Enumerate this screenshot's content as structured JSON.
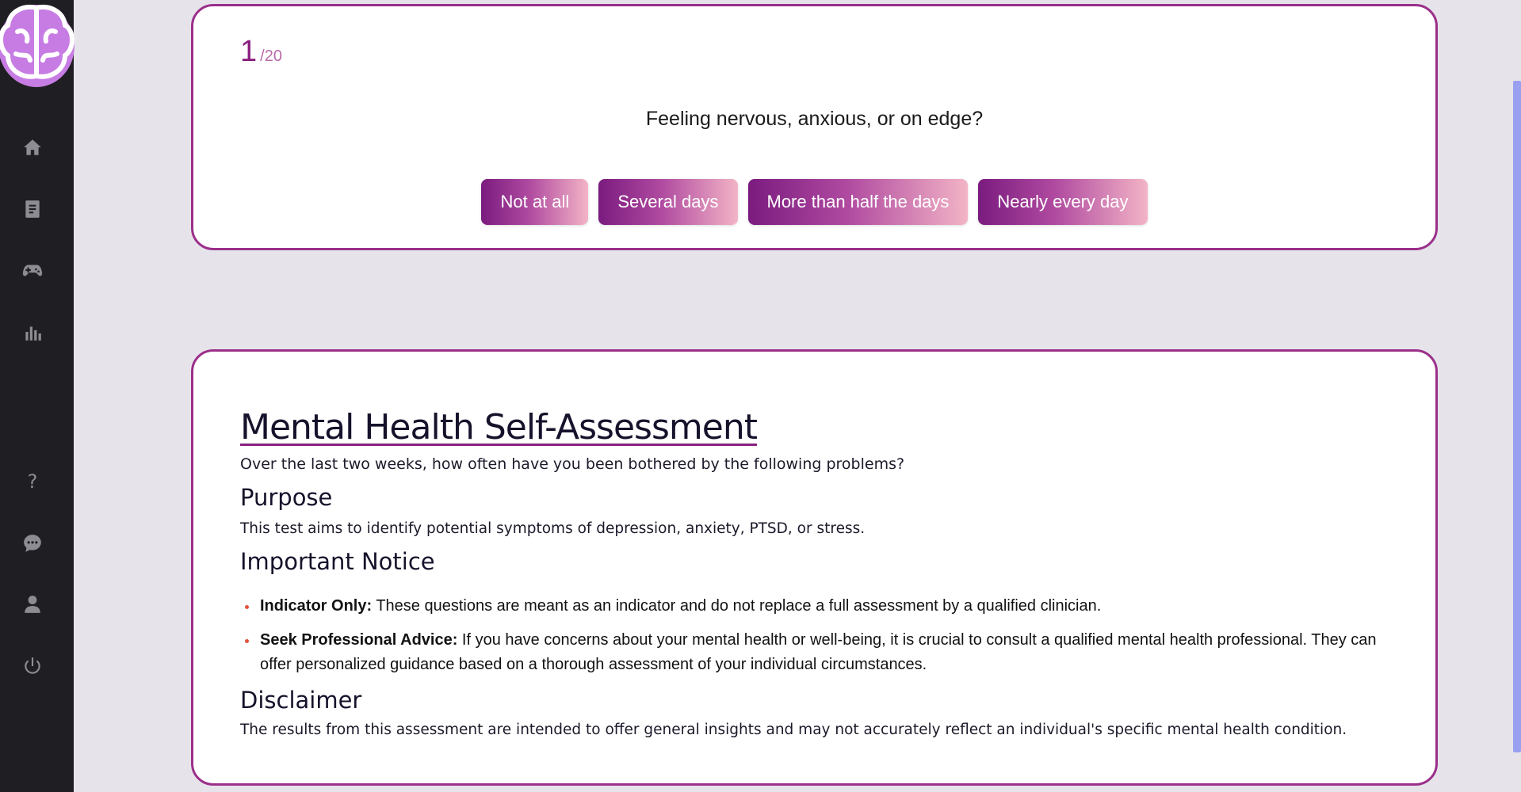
{
  "sidebar": {
    "items": [
      {
        "icon": "home-icon"
      },
      {
        "icon": "document-icon"
      },
      {
        "icon": "gamepad-icon"
      },
      {
        "icon": "bar-chart-icon"
      },
      {
        "icon": "help-icon",
        "glyph": "?"
      },
      {
        "icon": "chat-icon"
      },
      {
        "icon": "user-icon"
      },
      {
        "icon": "power-icon"
      }
    ]
  },
  "question": {
    "current": "1",
    "total": "/20",
    "text": "Feeling nervous, anxious, or on edge?",
    "options": [
      "Not at all",
      "Several days",
      "More than half the days",
      "Nearly every day"
    ]
  },
  "info": {
    "title": "Mental Health Self-Assessment",
    "subtitle": "Over the last two weeks, how often have you been bothered by the following problems?",
    "purpose_heading": "Purpose",
    "purpose_text": "This test aims to identify potential symptoms of depression, anxiety, PTSD, or stress.",
    "notice_heading": "Important Notice",
    "notices": [
      {
        "label": "Indicator Only:",
        "text": " These questions are meant as an indicator and do not replace a full assessment by a qualified clinician."
      },
      {
        "label": "Seek Professional Advice:",
        "text": " If you have concerns about your mental health or well-being, it is crucial to consult a qualified mental health professional. They can offer personalized guidance based on a thorough assessment of your individual circumstances."
      }
    ],
    "disclaimer_heading": "Disclaimer",
    "disclaimer_text": "The results from this assessment are intended to offer general insights and may not accurately reflect an individual's specific mental health condition."
  },
  "colors": {
    "accent": "#8a1e7f",
    "card_border": "#9b2f8a",
    "sidebar_bg": "#1f1e22",
    "page_bg": "#e6e4ea",
    "button_gradient_start": "#7a1b7f",
    "button_gradient_end": "#f3b4c6"
  }
}
